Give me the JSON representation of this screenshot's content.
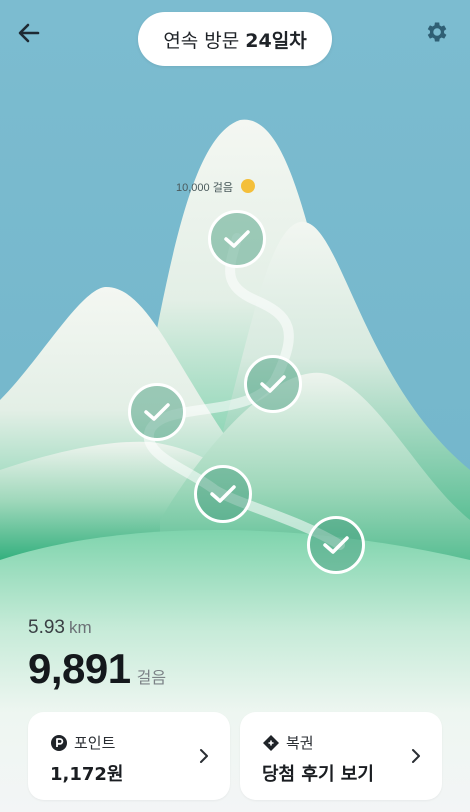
{
  "header": {
    "streak_prefix": "연속 방문",
    "streak_days": "24일차",
    "back_icon": "arrow-left-icon",
    "settings_icon": "gear-icon"
  },
  "scene": {
    "goal_label": "10,000 걸음",
    "checkpoints_completed": 5
  },
  "stats": {
    "distance_value": "5.93",
    "distance_unit": "km",
    "steps_value": "9,891",
    "steps_unit": "걸음"
  },
  "cards": {
    "points": {
      "icon": "point-p-icon",
      "label": "포인트",
      "value": "1,172원"
    },
    "lottery": {
      "icon": "ticket-icon",
      "label": "복권",
      "value": "당첨 후기 보기"
    }
  },
  "colors": {
    "sky": "#74b8cc",
    "mountain_green": "#3fbf8a",
    "goal_dot": "#f4bf3a",
    "card_bg": "#ffffff"
  }
}
